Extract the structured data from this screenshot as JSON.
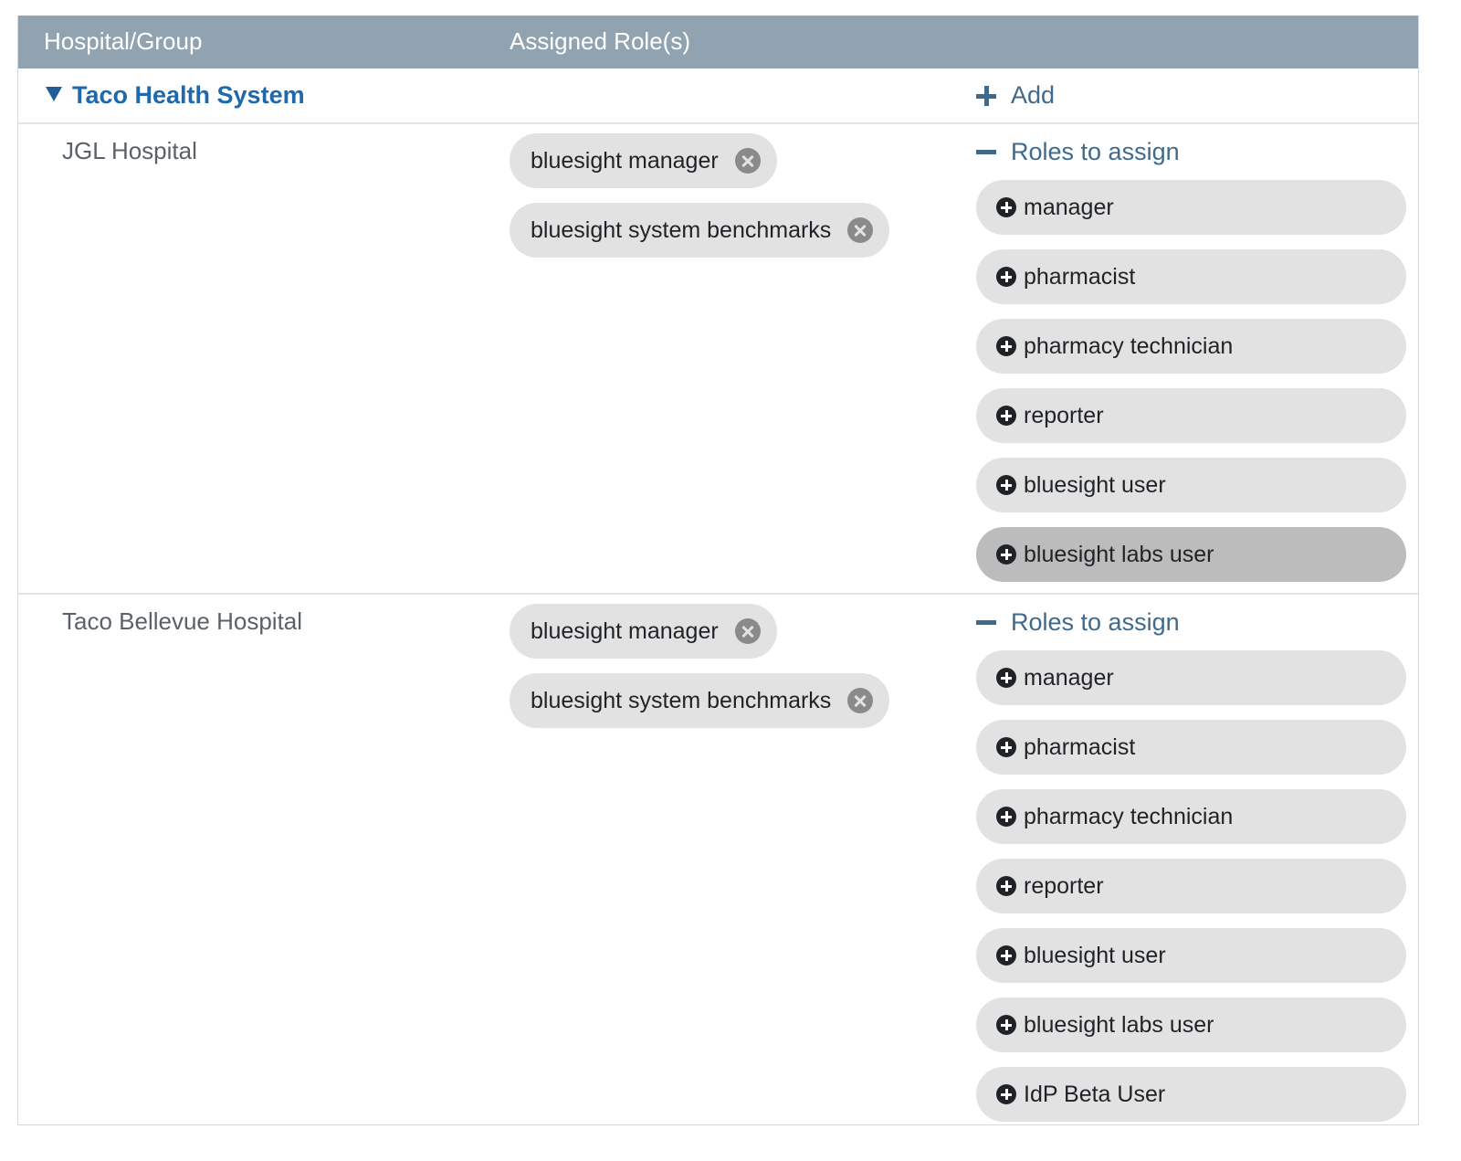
{
  "header": {
    "col_hospital": "Hospital/Group",
    "col_roles": "Assigned Role(s)"
  },
  "group": {
    "name": "Taco Health System",
    "add_label": "Add",
    "expanded": true
  },
  "hospitals": [
    {
      "name": "JGL Hospital",
      "assigned_roles": [
        "bluesight manager",
        "bluesight system benchmarks"
      ],
      "roles_to_assign_label": "Roles to assign",
      "available_roles": [
        "manager",
        "pharmacist",
        "pharmacy technician",
        "reporter",
        "bluesight user",
        "bluesight labs user"
      ],
      "hovered_role": "bluesight labs user"
    },
    {
      "name": "Taco Bellevue Hospital",
      "assigned_roles": [
        "bluesight manager",
        "bluesight system benchmarks"
      ],
      "roles_to_assign_label": "Roles to assign",
      "available_roles": [
        "manager",
        "pharmacist",
        "pharmacy technician",
        "reporter",
        "bluesight user",
        "bluesight labs user",
        "IdP Beta User"
      ],
      "hovered_role": ""
    }
  ],
  "colors": {
    "header_bg": "#91a3b0",
    "group_link": "#1e68ab",
    "accent": "#3f6a8b",
    "chip_bg": "#e2e2e2",
    "chip_hover_bg": "#bcbcbc"
  }
}
